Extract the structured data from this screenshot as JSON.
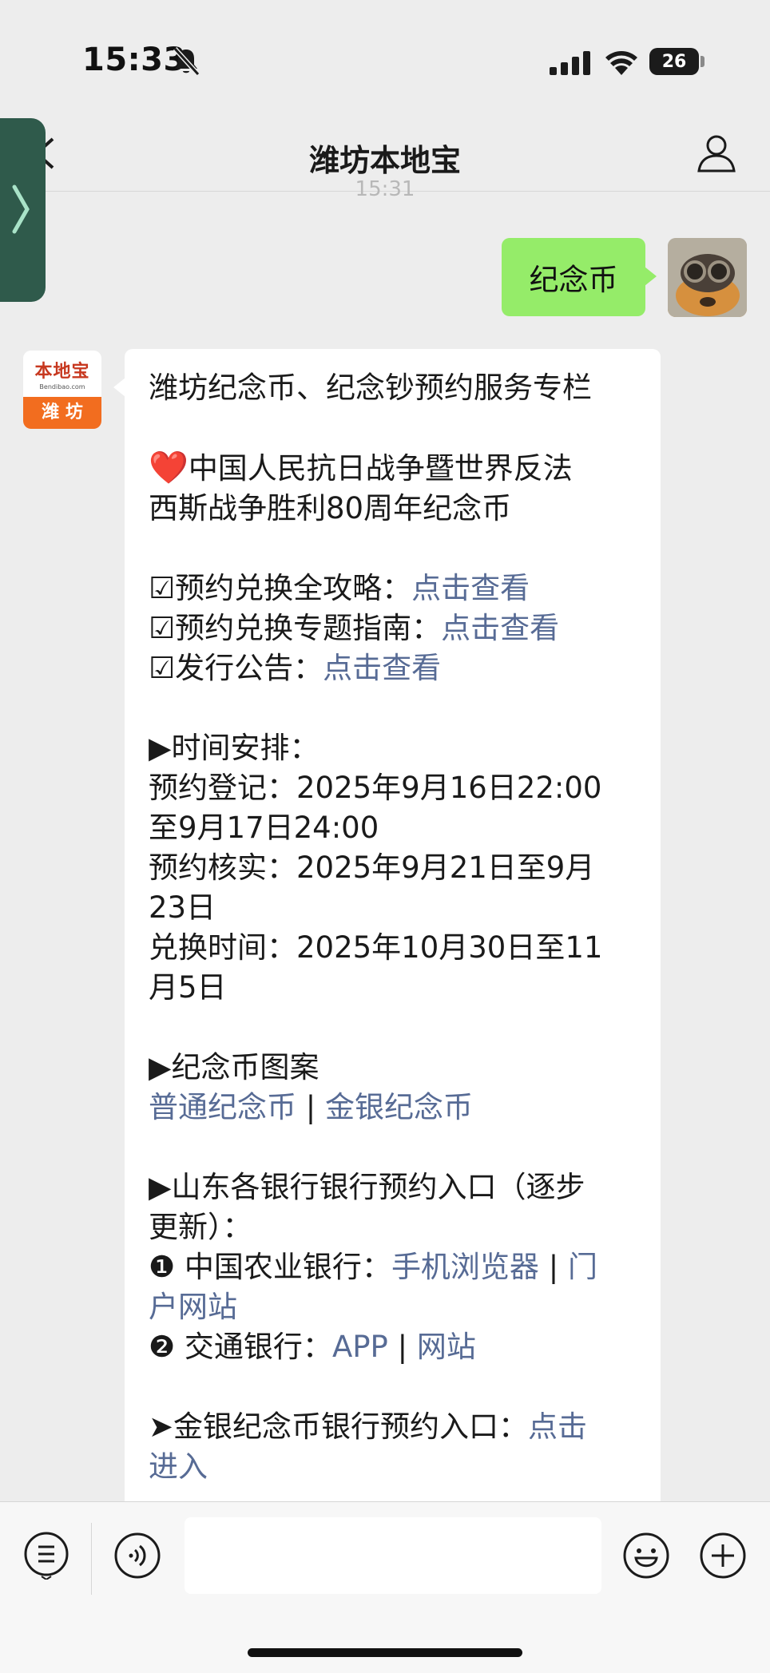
{
  "status_bar": {
    "time": "15:33",
    "battery": "26"
  },
  "nav": {
    "title": "潍坊本地宝"
  },
  "faded_timestamp": "15:31",
  "outgoing": {
    "text": "纪念币"
  },
  "bot": {
    "avatar_top": "本地宝",
    "avatar_sub": "Bendibao.com",
    "avatar_bottom": "潍 坊"
  },
  "message": {
    "title": "潍坊纪念币、纪念钞预约服务专栏",
    "heart": "❤️",
    "coin_line1": "中国人民抗日战争暨世界反法",
    "coin_line2": "西斯战争胜利80周年纪念币",
    "guide1_label": "☑预约兑换全攻略：",
    "guide1_link": "点击查看",
    "guide2_label": "☑预约兑换专题指南：",
    "guide2_link": "点击查看",
    "guide3_label": "☑发行公告：",
    "guide3_link": "点击查看",
    "schedule_heading": "▶时间安排：",
    "schedule_line1": "预约登记：2025年9月16日22:00",
    "schedule_line2": "至9月17日24:00",
    "schedule_line3": "预约核实：2025年9月21日至9月",
    "schedule_line4": "23日",
    "schedule_line5": "兑换时间：2025年10月30日至11",
    "schedule_line6": "月5日",
    "design_heading": "▶纪念币图案",
    "design_link1": "普通纪念币",
    "design_sep": " | ",
    "design_link2": "金银纪念币",
    "bank_heading1": "▶山东各银行银行预约入口（逐步",
    "bank_heading2": "更新）：",
    "bank1_label": "❶ 中国农业银行：",
    "bank1_link1": "手机浏览器",
    "bank1_sep": " | ",
    "bank1_link2a": "门",
    "bank1_link2b": "户网站",
    "bank2_label": "❷ 交通银行：",
    "bank2_link1": "APP",
    "bank2_sep": " | ",
    "bank2_link2": "网站",
    "gold_label": "➤金银纪念币银行预约入口：",
    "gold_link_a": "点击",
    "gold_link_b": "进入"
  },
  "input": {
    "placeholder": ""
  }
}
